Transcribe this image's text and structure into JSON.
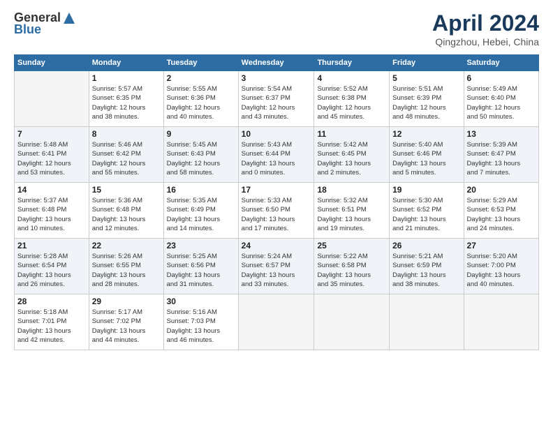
{
  "logo": {
    "general": "General",
    "blue": "Blue"
  },
  "title": "April 2024",
  "location": "Qingzhou, Hebei, China",
  "headers": [
    "Sunday",
    "Monday",
    "Tuesday",
    "Wednesday",
    "Thursday",
    "Friday",
    "Saturday"
  ],
  "weeks": [
    [
      {
        "day": "",
        "info": ""
      },
      {
        "day": "1",
        "info": "Sunrise: 5:57 AM\nSunset: 6:35 PM\nDaylight: 12 hours\nand 38 minutes."
      },
      {
        "day": "2",
        "info": "Sunrise: 5:55 AM\nSunset: 6:36 PM\nDaylight: 12 hours\nand 40 minutes."
      },
      {
        "day": "3",
        "info": "Sunrise: 5:54 AM\nSunset: 6:37 PM\nDaylight: 12 hours\nand 43 minutes."
      },
      {
        "day": "4",
        "info": "Sunrise: 5:52 AM\nSunset: 6:38 PM\nDaylight: 12 hours\nand 45 minutes."
      },
      {
        "day": "5",
        "info": "Sunrise: 5:51 AM\nSunset: 6:39 PM\nDaylight: 12 hours\nand 48 minutes."
      },
      {
        "day": "6",
        "info": "Sunrise: 5:49 AM\nSunset: 6:40 PM\nDaylight: 12 hours\nand 50 minutes."
      }
    ],
    [
      {
        "day": "7",
        "info": "Sunrise: 5:48 AM\nSunset: 6:41 PM\nDaylight: 12 hours\nand 53 minutes."
      },
      {
        "day": "8",
        "info": "Sunrise: 5:46 AM\nSunset: 6:42 PM\nDaylight: 12 hours\nand 55 minutes."
      },
      {
        "day": "9",
        "info": "Sunrise: 5:45 AM\nSunset: 6:43 PM\nDaylight: 12 hours\nand 58 minutes."
      },
      {
        "day": "10",
        "info": "Sunrise: 5:43 AM\nSunset: 6:44 PM\nDaylight: 13 hours\nand 0 minutes."
      },
      {
        "day": "11",
        "info": "Sunrise: 5:42 AM\nSunset: 6:45 PM\nDaylight: 13 hours\nand 2 minutes."
      },
      {
        "day": "12",
        "info": "Sunrise: 5:40 AM\nSunset: 6:46 PM\nDaylight: 13 hours\nand 5 minutes."
      },
      {
        "day": "13",
        "info": "Sunrise: 5:39 AM\nSunset: 6:47 PM\nDaylight: 13 hours\nand 7 minutes."
      }
    ],
    [
      {
        "day": "14",
        "info": "Sunrise: 5:37 AM\nSunset: 6:48 PM\nDaylight: 13 hours\nand 10 minutes."
      },
      {
        "day": "15",
        "info": "Sunrise: 5:36 AM\nSunset: 6:48 PM\nDaylight: 13 hours\nand 12 minutes."
      },
      {
        "day": "16",
        "info": "Sunrise: 5:35 AM\nSunset: 6:49 PM\nDaylight: 13 hours\nand 14 minutes."
      },
      {
        "day": "17",
        "info": "Sunrise: 5:33 AM\nSunset: 6:50 PM\nDaylight: 13 hours\nand 17 minutes."
      },
      {
        "day": "18",
        "info": "Sunrise: 5:32 AM\nSunset: 6:51 PM\nDaylight: 13 hours\nand 19 minutes."
      },
      {
        "day": "19",
        "info": "Sunrise: 5:30 AM\nSunset: 6:52 PM\nDaylight: 13 hours\nand 21 minutes."
      },
      {
        "day": "20",
        "info": "Sunrise: 5:29 AM\nSunset: 6:53 PM\nDaylight: 13 hours\nand 24 minutes."
      }
    ],
    [
      {
        "day": "21",
        "info": "Sunrise: 5:28 AM\nSunset: 6:54 PM\nDaylight: 13 hours\nand 26 minutes."
      },
      {
        "day": "22",
        "info": "Sunrise: 5:26 AM\nSunset: 6:55 PM\nDaylight: 13 hours\nand 28 minutes."
      },
      {
        "day": "23",
        "info": "Sunrise: 5:25 AM\nSunset: 6:56 PM\nDaylight: 13 hours\nand 31 minutes."
      },
      {
        "day": "24",
        "info": "Sunrise: 5:24 AM\nSunset: 6:57 PM\nDaylight: 13 hours\nand 33 minutes."
      },
      {
        "day": "25",
        "info": "Sunrise: 5:22 AM\nSunset: 6:58 PM\nDaylight: 13 hours\nand 35 minutes."
      },
      {
        "day": "26",
        "info": "Sunrise: 5:21 AM\nSunset: 6:59 PM\nDaylight: 13 hours\nand 38 minutes."
      },
      {
        "day": "27",
        "info": "Sunrise: 5:20 AM\nSunset: 7:00 PM\nDaylight: 13 hours\nand 40 minutes."
      }
    ],
    [
      {
        "day": "28",
        "info": "Sunrise: 5:18 AM\nSunset: 7:01 PM\nDaylight: 13 hours\nand 42 minutes."
      },
      {
        "day": "29",
        "info": "Sunrise: 5:17 AM\nSunset: 7:02 PM\nDaylight: 13 hours\nand 44 minutes."
      },
      {
        "day": "30",
        "info": "Sunrise: 5:16 AM\nSunset: 7:03 PM\nDaylight: 13 hours\nand 46 minutes."
      },
      {
        "day": "",
        "info": ""
      },
      {
        "day": "",
        "info": ""
      },
      {
        "day": "",
        "info": ""
      },
      {
        "day": "",
        "info": ""
      }
    ]
  ]
}
